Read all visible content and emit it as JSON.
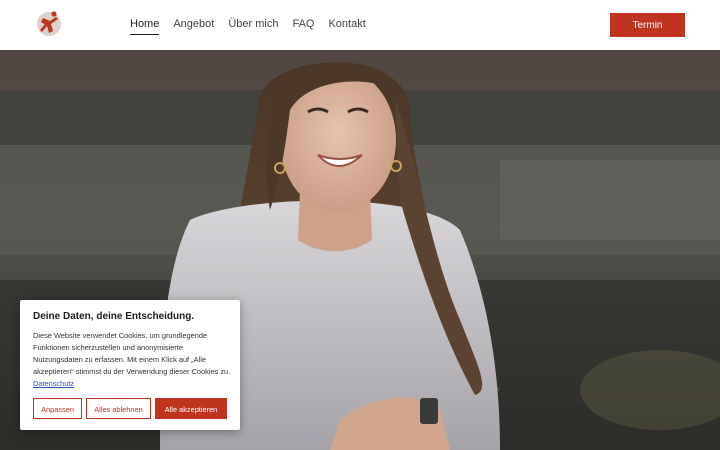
{
  "nav": {
    "items": [
      {
        "label": "Home",
        "active": true
      },
      {
        "label": "Angebot"
      },
      {
        "label": "Über mich"
      },
      {
        "label": "FAQ"
      },
      {
        "label": "Kontakt"
      }
    ],
    "cta_label": "Termin"
  },
  "cookie": {
    "title": "Deine Daten, deine Entscheidung.",
    "text": "Diese Website verwendet Cookies, um grundlegende Funktionen sicherzustellen und anonymisierte Nutzungsdaten zu erfassen. Mit einem Klick auf „Alle akzeptieren“ stimmst du der Verwendung dieser Cookies zu.",
    "link_label": "Datenschutz",
    "buttons": {
      "customize": "Anpassen",
      "reject": "Alles ablehnen",
      "accept": "Alle akzeptieren"
    }
  },
  "colors": {
    "accent": "#c0331f",
    "link": "#2b55c4"
  },
  "icons": {
    "logo": "running-figure-logo"
  }
}
